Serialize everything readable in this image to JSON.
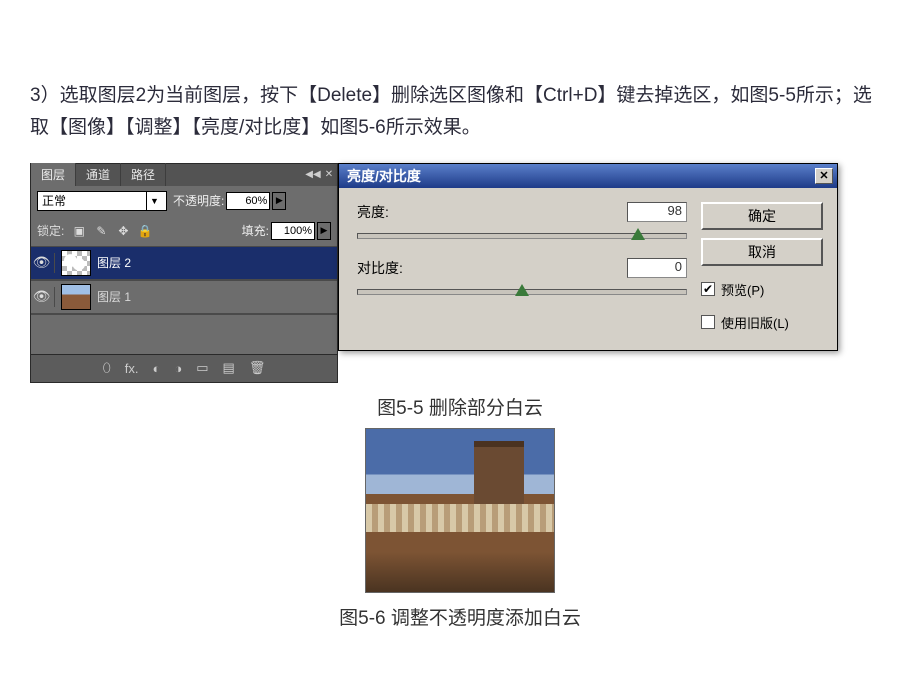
{
  "instruction": "3）选取图层2为当前图层，按下【Delete】删除选区图像和【Ctrl+D】键去掉选区，如图5-5所示；选取【图像】【调整】【亮度/对比度】如图5-6所示效果。",
  "layers_panel": {
    "tabs": {
      "layers": "图层",
      "channels": "通道",
      "paths": "路径"
    },
    "blend_mode": "正常",
    "opacity_label": "不透明度:",
    "opacity_value": "60%",
    "lock_label": "锁定:",
    "fill_label": "填充:",
    "fill_value": "100%",
    "layers": [
      {
        "name": "图层 2"
      },
      {
        "name": "图层 1"
      }
    ]
  },
  "bc_dialog": {
    "title": "亮度/对比度",
    "brightness_label": "亮度:",
    "brightness_value": "98",
    "contrast_label": "对比度:",
    "contrast_value": "0",
    "ok": "确定",
    "cancel": "取消",
    "preview": "预览(P)",
    "legacy": "使用旧版(L)"
  },
  "captions": {
    "fig55": "图5-5 删除部分白云",
    "fig56": "图5-6 调整不透明度添加白云"
  }
}
